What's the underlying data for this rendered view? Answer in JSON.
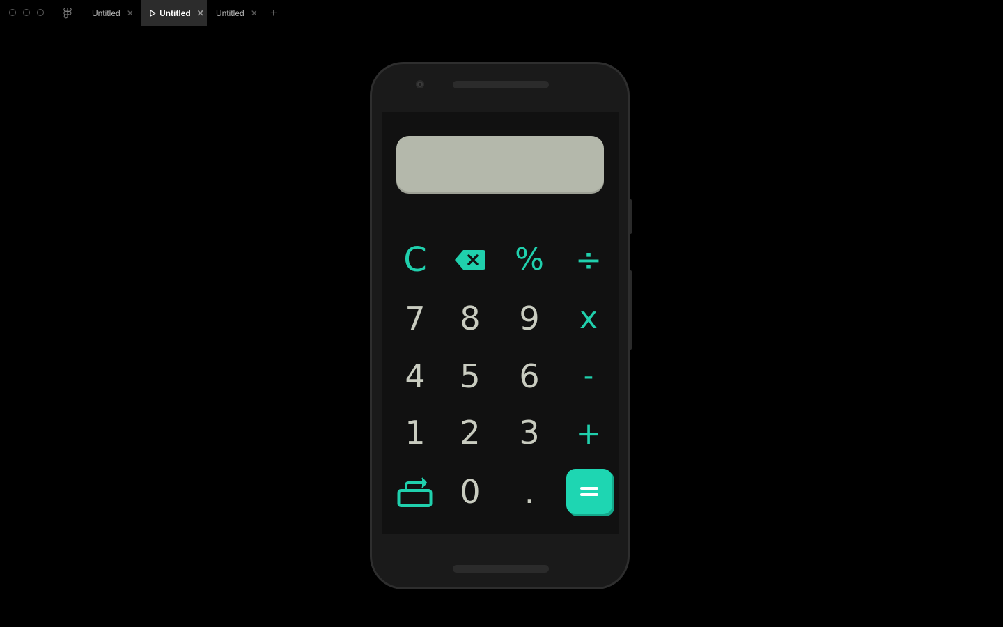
{
  "titlebar": {
    "tabs": [
      {
        "label": "Untitled",
        "active": false
      },
      {
        "label": "Untitled",
        "active": true
      },
      {
        "label": "Untitled",
        "active": false
      }
    ],
    "new_tab_label": "+"
  },
  "calculator": {
    "display_value": "",
    "colors": {
      "accent": "#20d0ad",
      "digit": "#c9ccc0",
      "display_bg": "#b4b8ab",
      "screen_bg": "#111111"
    },
    "keys": {
      "clear": "C",
      "backspace": "backspace-icon",
      "percent": "%",
      "divide": "÷",
      "seven": "7",
      "eight": "8",
      "nine": "9",
      "multiply": "x",
      "four": "4",
      "five": "5",
      "six": "6",
      "minus": "-",
      "one": "1",
      "two": "2",
      "three": "3",
      "plus": "+",
      "history": "history-icon",
      "zero": "0",
      "decimal": ".",
      "equals": "equals-icon"
    }
  }
}
